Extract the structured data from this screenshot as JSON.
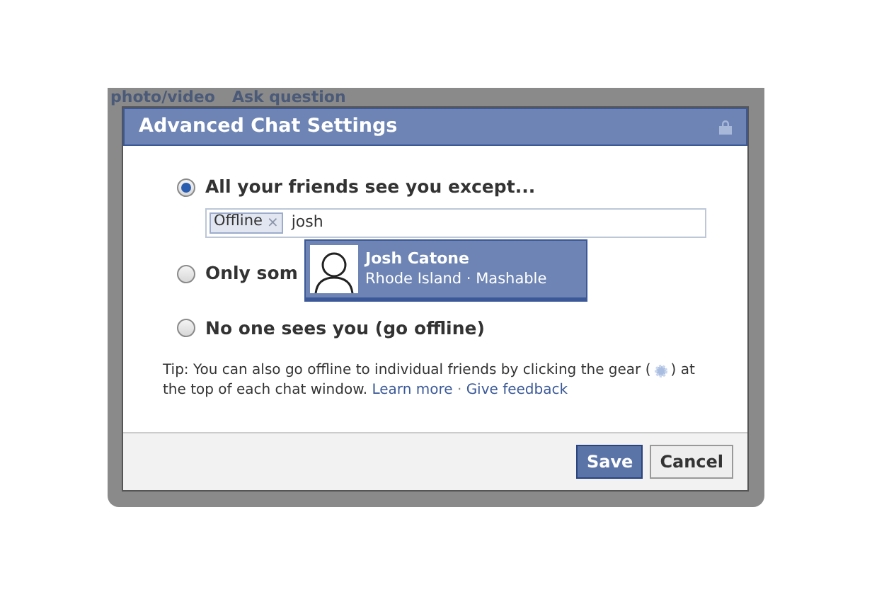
{
  "background": {
    "links": [
      "photo/video",
      "Ask question"
    ]
  },
  "dialog": {
    "title": "Advanced Chat Settings",
    "options": [
      {
        "label": "All your friends see you except...",
        "selected": true
      },
      {
        "label": "Only som",
        "selected": false
      },
      {
        "label": "No one sees you (go offline)",
        "selected": false
      }
    ],
    "token_field": {
      "tokens": [
        "Offline"
      ],
      "token_remove": "×",
      "value": "josh"
    },
    "suggestion": {
      "name": "Josh Catone",
      "detail": "Rhode Island · Mashable"
    },
    "tip": {
      "before": "Tip: You can also go offline to individual friends by clicking the gear (",
      "after": ") at the top of each chat window.",
      "links": [
        "Learn more",
        "Give feedback"
      ],
      "separator": "·"
    },
    "buttons": [
      {
        "label": "Save",
        "kind": "primary"
      },
      {
        "label": "Cancel",
        "kind": "secondary"
      }
    ]
  }
}
